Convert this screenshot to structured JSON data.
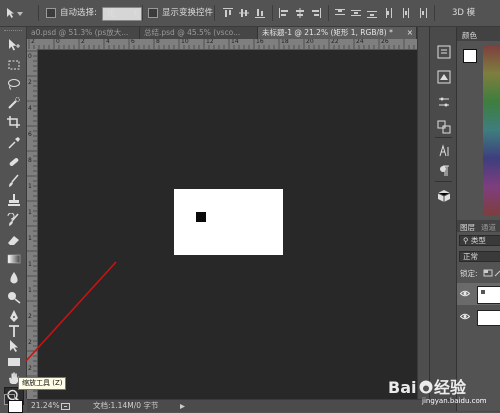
{
  "options_bar": {
    "auto_select_label": "自动选择:",
    "auto_select_value": "组",
    "show_transform_label": "显示变换控件",
    "mode_3d_label": "3D 模"
  },
  "tabs": [
    {
      "label": "a0.psd @ 51.3% (ps放大...",
      "active": false
    },
    {
      "label": "总结.psd @ 45.5% (vsco...",
      "active": false
    },
    {
      "label": "未标题-1 @ 21.2% (矩形 1, RGB/8) *",
      "active": true
    }
  ],
  "ruler": {
    "h_numbers": [
      "2",
      "0",
      "2",
      "4",
      "6",
      "8",
      "10",
      "12",
      "14",
      "16",
      "18",
      "20",
      "22",
      "24",
      "26"
    ],
    "v_numbers": [
      "0",
      "2",
      "4",
      "6",
      "8",
      "1",
      "1",
      "1",
      "1",
      "1",
      "2",
      "2",
      "2"
    ]
  },
  "status": {
    "zoom": "21.24%",
    "doc_info": "文档:1.14M/0 字节"
  },
  "tooltip": "缩放工具 (Z)",
  "panels": {
    "color_tab": "颜色",
    "layers_tab": "图层",
    "channels_tab": "通道",
    "kind_label": "类型",
    "blend_mode": "正常",
    "lock_label": "锁定:"
  },
  "watermark": {
    "logo_text": "Bai du 经验",
    "url": "jingyan.baidu.com"
  },
  "colors": {
    "background": "#535353",
    "canvas_area": "#282828",
    "document": "#ffffff",
    "shape_fill": "#0a0a0a",
    "annotation_arrow": "#cc1111"
  },
  "icons": {
    "toolbar": [
      "move-icon",
      "marquee-icon",
      "lasso-icon",
      "quick-select-icon",
      "crop-icon",
      "eyedropper-icon",
      "healing-brush-icon",
      "brush-icon",
      "clone-stamp-icon",
      "history-brush-icon",
      "eraser-icon",
      "gradient-icon",
      "blur-icon",
      "dodge-icon",
      "pen-icon",
      "type-icon",
      "path-select-icon",
      "rectangle-icon",
      "hand-icon",
      "zoom-icon"
    ]
  }
}
